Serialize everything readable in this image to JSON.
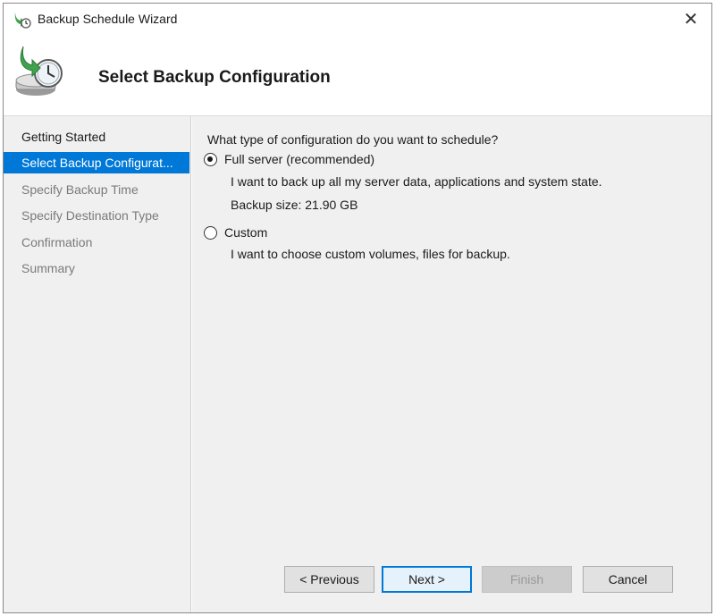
{
  "window": {
    "title": "Backup Schedule Wizard",
    "close_glyph": "✕"
  },
  "header": {
    "title": "Select Backup Configuration",
    "icon": "backup-clock-icon"
  },
  "steps": [
    {
      "label": "Getting Started",
      "state": "done"
    },
    {
      "label": "Select Backup Configurat...",
      "state": "active"
    },
    {
      "label": "Specify Backup Time",
      "state": "pending"
    },
    {
      "label": "Specify Destination Type",
      "state": "pending"
    },
    {
      "label": "Confirmation",
      "state": "pending"
    },
    {
      "label": "Summary",
      "state": "pending"
    }
  ],
  "main": {
    "question": "What type of configuration do you want to schedule?",
    "options": [
      {
        "label": "Full server (recommended)",
        "selected": true,
        "description": "I want to back up all my server data, applications and system state.",
        "size_text": "Backup size: 21.90 GB"
      },
      {
        "label": "Custom",
        "selected": false,
        "description": "I want to choose custom volumes, files for backup."
      }
    ]
  },
  "footer": {
    "previous_label": "< Previous",
    "next_label": "Next >",
    "finish_label": "Finish",
    "cancel_label": "Cancel"
  },
  "colors": {
    "accent": "#0078d7",
    "panel_bg": "#f0f0f0"
  }
}
